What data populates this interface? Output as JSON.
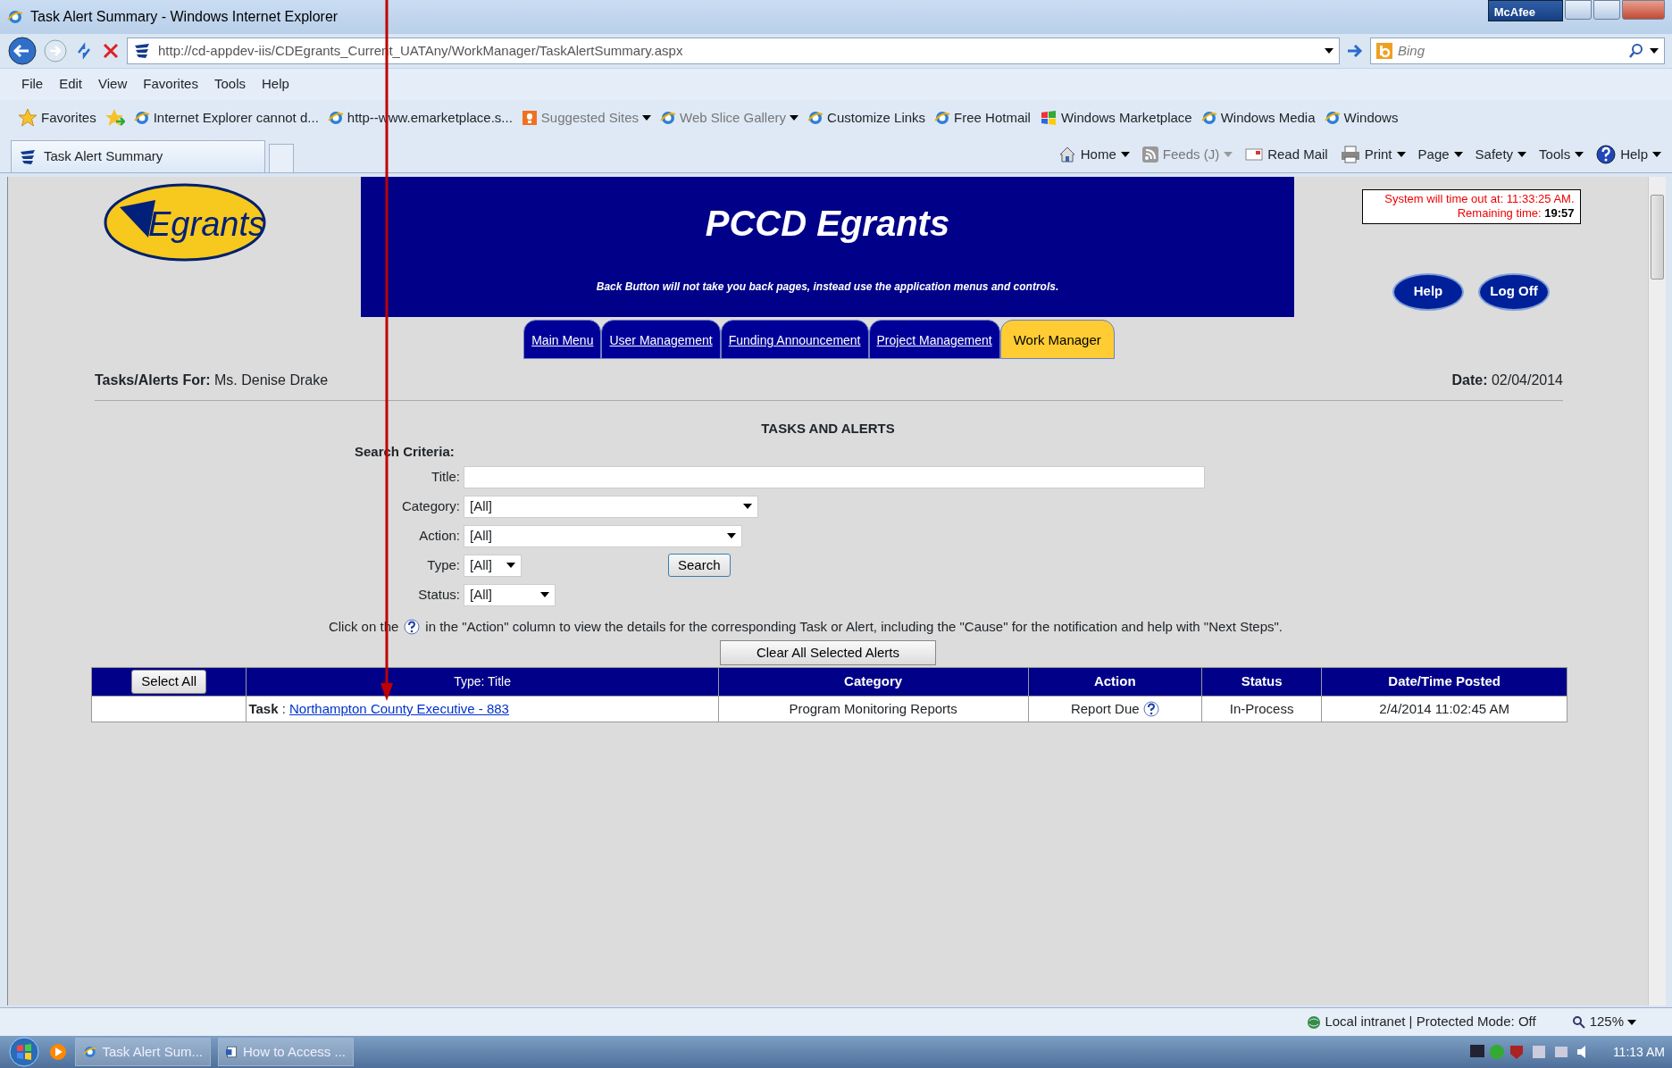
{
  "window": {
    "title": "Task Alert Summary - Windows Internet Explorer",
    "security_badge": "McAfee"
  },
  "address_bar": {
    "url": "http://cd-appdev-iis/CDEgrants_Current_UATAny/WorkManager/TaskAlertSummary.aspx",
    "search_placeholder": "Bing"
  },
  "menu": [
    "File",
    "Edit",
    "View",
    "Favorites",
    "Tools",
    "Help"
  ],
  "favorites_bar": {
    "label": "Favorites",
    "links": [
      {
        "label": "Internet Explorer cannot d...",
        "kind": "page",
        "dropdown": false,
        "dimmed": false
      },
      {
        "label": "http--www.emarketplace.s...",
        "kind": "page",
        "dropdown": false,
        "dimmed": false
      },
      {
        "label": "Suggested Sites",
        "kind": "suggested",
        "dropdown": true,
        "dimmed": true
      },
      {
        "label": "Web Slice Gallery",
        "kind": "page",
        "dropdown": true,
        "dimmed": true
      },
      {
        "label": "Customize Links",
        "kind": "page",
        "dropdown": false,
        "dimmed": false
      },
      {
        "label": "Free Hotmail",
        "kind": "page",
        "dropdown": false,
        "dimmed": false
      },
      {
        "label": "Windows Marketplace",
        "kind": "marketplace",
        "dropdown": false,
        "dimmed": false
      },
      {
        "label": "Windows Media",
        "kind": "page",
        "dropdown": false,
        "dimmed": false
      },
      {
        "label": "Windows",
        "kind": "page",
        "dropdown": false,
        "dimmed": false
      }
    ]
  },
  "browser_tabs": [
    {
      "label": "Task Alert Summary",
      "selected": true
    }
  ],
  "command_bar": [
    {
      "label": "Home",
      "kind": "home",
      "dropdown": true,
      "disabled": false
    },
    {
      "label": "Feeds (J)",
      "kind": "feed",
      "dropdown": true,
      "disabled": true
    },
    {
      "label": "Read Mail",
      "kind": "mail",
      "dropdown": false,
      "disabled": false
    },
    {
      "label": "Print",
      "kind": "print",
      "dropdown": true,
      "disabled": false
    },
    {
      "label": "Page",
      "kind": "menu",
      "dropdown": true,
      "disabled": false
    },
    {
      "label": "Safety",
      "kind": "menu",
      "dropdown": true,
      "disabled": false
    },
    {
      "label": "Tools",
      "kind": "menu",
      "dropdown": true,
      "disabled": false
    },
    {
      "label": "Help",
      "kind": "help",
      "dropdown": true,
      "disabled": false
    }
  ],
  "page": {
    "logo_text": "Egrants",
    "app_title": "PCCD Egrants",
    "banner_note": "Back Button will not take you back pages, instead use the application menus and controls.",
    "timeout": {
      "label": "System will time out at: 11:33:25 AM.",
      "remaining_label": "Remaining time:",
      "remaining": "19:57"
    },
    "header_buttons": [
      "Help",
      "Log Off"
    ],
    "nav_tabs": [
      {
        "label": "Main Menu",
        "selected": false
      },
      {
        "label": "User Management",
        "selected": false
      },
      {
        "label": "Funding Announcement",
        "selected": false
      },
      {
        "label": "Project Management",
        "selected": false
      },
      {
        "label": "Work Manager",
        "selected": true
      }
    ],
    "user": {
      "label": "Tasks/Alerts For:",
      "value": "Ms. Denise Drake"
    },
    "date": {
      "label": "Date:",
      "value": "02/04/2014"
    },
    "section_title": "TASKS AND ALERTS",
    "search": {
      "heading": "Search Criteria:",
      "fields": [
        {
          "label": "Title:",
          "kind": "text"
        },
        {
          "label": "Category:",
          "kind": "select",
          "value": "[All]"
        },
        {
          "label": "Action:",
          "kind": "select",
          "value": "[All]"
        },
        {
          "label": "Type:",
          "kind": "select",
          "value": "[All]"
        },
        {
          "label": "Status:",
          "kind": "select",
          "value": "[All]"
        }
      ],
      "button": "Search"
    },
    "hint": [
      "Click on the",
      "in the \"Action\" column to view the details for the corresponding Task or Alert, including the \"Cause\" for the notification and help with \"Next Steps\"."
    ],
    "clear_button": "Clear All Selected Alerts",
    "table": {
      "select_all": "Select All",
      "type_title": [
        "Type",
        ":",
        "Title"
      ],
      "columns": [
        "Category",
        "Action",
        "Status",
        "Date/Time Posted"
      ],
      "rows": [
        {
          "type": "Task",
          "separator": ":",
          "title": "Northampton County Executive - 883",
          "category": "Program Monitoring Reports",
          "action": "Report Due",
          "status": "In-Process",
          "posted": "2/4/2014 11:02:45 AM"
        }
      ]
    }
  },
  "status_bar": {
    "zone": "Local intranet | Protected Mode: Off",
    "zoom": "125%"
  },
  "taskbar": {
    "items": [
      {
        "label": "Task Alert Sum...",
        "kind": "browser"
      },
      {
        "label": "How to Access ...",
        "kind": "document"
      }
    ],
    "clock": "11:13 AM"
  }
}
